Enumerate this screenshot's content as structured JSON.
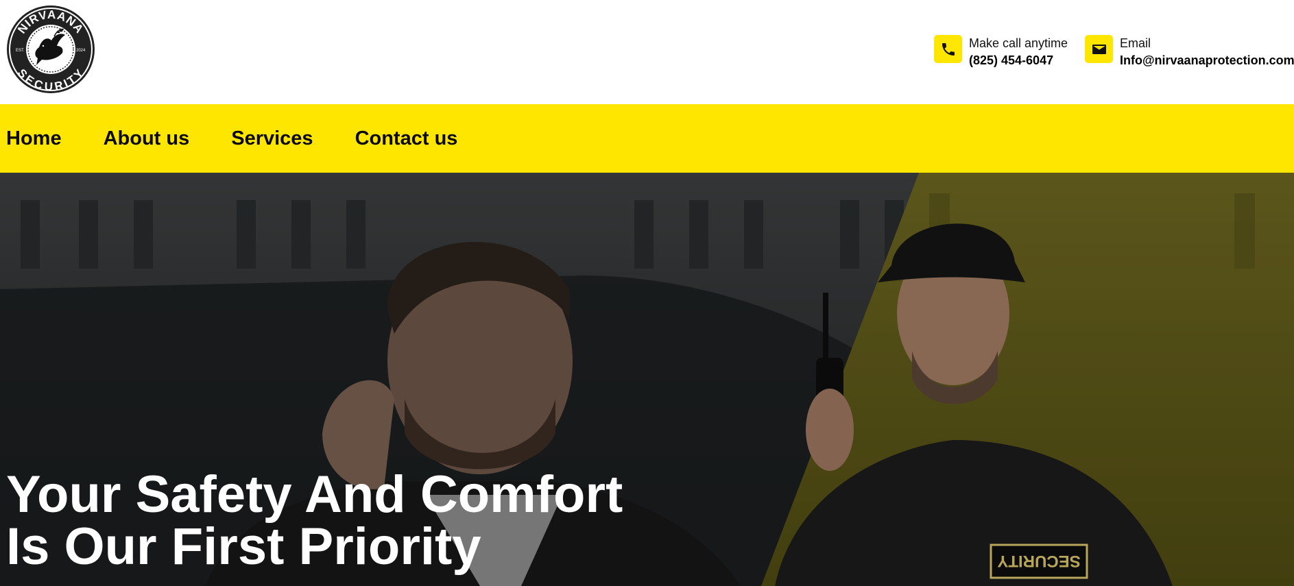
{
  "brand": {
    "logo_top_text": "NIRVAANA",
    "logo_bottom_text": "SECURITY",
    "logo_left_text": "EST.",
    "logo_right_text": "2024"
  },
  "header": {
    "phone": {
      "caption": "Make call anytime",
      "value": "(825) 454-6047",
      "icon": "phone-icon"
    },
    "email": {
      "caption": "Email",
      "value": "Info@nirvaanaprotection.com",
      "icon": "mail-icon"
    }
  },
  "nav": {
    "items": [
      {
        "label": "Home"
      },
      {
        "label": "About us"
      },
      {
        "label": "Services"
      },
      {
        "label": "Contact us"
      }
    ]
  },
  "hero": {
    "title_line1": "Your Safety And Comfort",
    "title_line2": "Is Our First Priority",
    "badge_text": "SECURITY"
  },
  "colors": {
    "accent": "#ffe600",
    "nav_text": "#0b0b0b",
    "hero_overlay": "#2a2c2d"
  }
}
